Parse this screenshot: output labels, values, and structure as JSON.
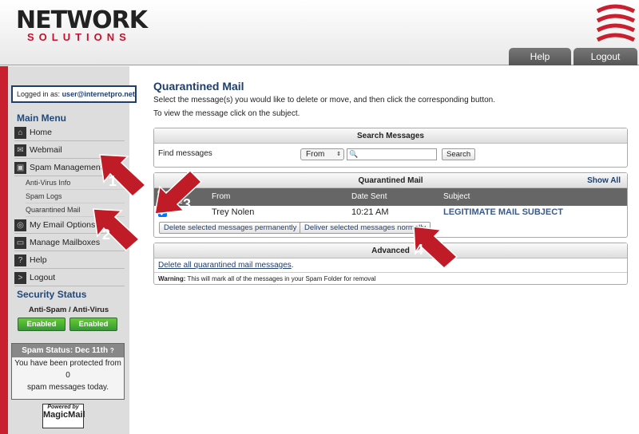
{
  "header": {
    "logo_top": "NETWORK",
    "logo_bottom": "SOLUTIONS",
    "tabs": [
      "Help",
      "Logout"
    ]
  },
  "sidebar": {
    "logged_in_label": "Logged in as:",
    "user": "user@internetpro.net",
    "main_menu": "Main Menu",
    "items": [
      {
        "label": "Home",
        "icon": "home-icon"
      },
      {
        "label": "Webmail",
        "icon": "envelope-icon"
      },
      {
        "label": "Spam Management",
        "icon": "lock-icon"
      },
      {
        "label": "My Email Options",
        "icon": "options-icon"
      },
      {
        "label": "Manage Mailboxes",
        "icon": "mailbox-icon"
      },
      {
        "label": "Help",
        "icon": "question-icon"
      },
      {
        "label": "Logout",
        "icon": "logout-icon"
      }
    ],
    "sub_items": [
      "Anti-Virus Info",
      "Spam Logs",
      "Quarantined Mail"
    ],
    "security_status": "Security Status",
    "security_sub": "Anti-Spam / Anti-Virus",
    "enabled": [
      "Enabled",
      "Enabled"
    ],
    "spam_status_title": "Spam Status: Dec 11th",
    "spam_line1": "You have been protected from",
    "spam_count": "0",
    "spam_line2": "spam messages today.",
    "powered_by": "Powered by",
    "magicmail": "MagicMail"
  },
  "main": {
    "title": "Quarantined Mail",
    "instr1": "Select the message(s) you would like to delete or move, and then click the corresponding button.",
    "instr2": "To view the message click on the subject.",
    "search": {
      "header": "Search Messages",
      "label": "Find messages",
      "select": "From",
      "input": "",
      "button": "Search"
    },
    "qm": {
      "header": "Quarantined Mail",
      "show_all": "Show All",
      "col_check": "Check / Uncheck",
      "col_from": "From",
      "col_date": "Date Sent",
      "col_subject": "Subject",
      "rows": [
        {
          "checked": true,
          "from": "Trey Nolen",
          "date": "10:21 AM",
          "subject": "LEGITIMATE MAIL SUBJECT"
        }
      ],
      "delete_btn": "Delete selected messages permanently",
      "deliver_btn": "Deliver selected messages normally"
    },
    "advanced": {
      "header": "Advanced",
      "link": "Delete all quarantined mail messages",
      "warning_label": "Warning:",
      "warning": "This will mark all of the messages in your Spam Folder for removal"
    }
  },
  "annotations": [
    "1",
    "2",
    "3",
    "4"
  ],
  "colors": {
    "brand_red": "#c8202e",
    "navy": "#1f3e6b",
    "green": "#44aa33"
  }
}
